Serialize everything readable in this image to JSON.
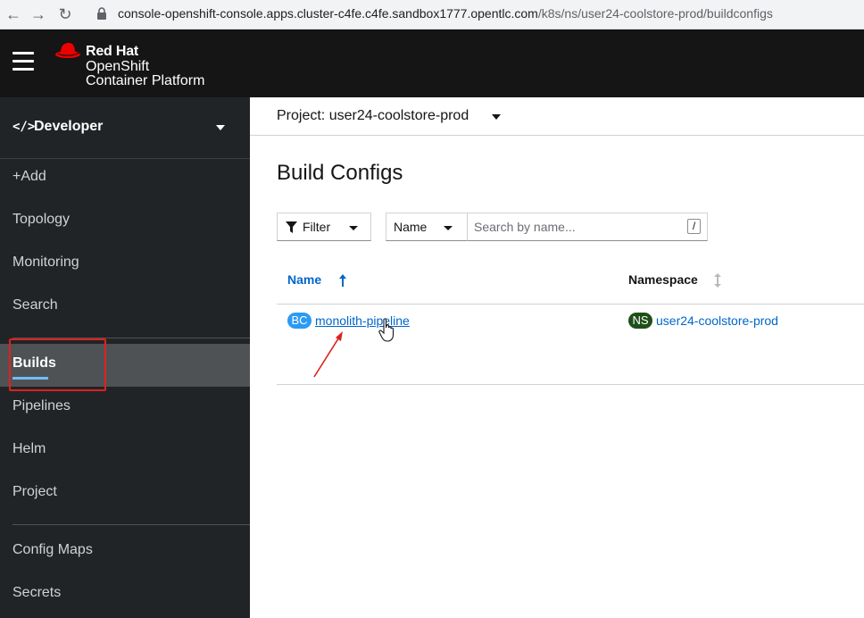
{
  "browser": {
    "url_main": "console-openshift-console.apps.cluster-c4fe.c4fe.sandbox1777.opentlc.com",
    "url_path": "/k8s/ns/user24-coolstore-prod/buildconfigs"
  },
  "masthead": {
    "brand_line1": "Red Hat",
    "brand_line2": "OpenShift",
    "brand_line3": "Container Platform"
  },
  "sidebar": {
    "perspective": "Developer",
    "items": [
      {
        "label": "+Add"
      },
      {
        "label": "Topology"
      },
      {
        "label": "Monitoring"
      },
      {
        "label": "Search"
      },
      {
        "label": "Builds",
        "active": true
      },
      {
        "label": "Pipelines"
      },
      {
        "label": "Helm"
      },
      {
        "label": "Project"
      },
      {
        "label": "Config Maps"
      },
      {
        "label": "Secrets"
      }
    ]
  },
  "main": {
    "project_label": "Project: user24-coolstore-prod",
    "title": "Build Configs",
    "filter_label": "Filter",
    "filter_type": "Name",
    "search_placeholder": "Search by name...",
    "search_shortcut": "/",
    "columns": [
      "Name",
      "Namespace"
    ],
    "rows": [
      {
        "name_badge": "BC",
        "name": "monolith-pipeline",
        "ns_badge": "NS",
        "namespace": "user24-coolstore-prod"
      }
    ]
  },
  "colors": {
    "masthead": "#151515",
    "sidebar": "#212427",
    "active_item": "#4f5255",
    "link": "#0066cc",
    "highlight": "#e0201e"
  }
}
